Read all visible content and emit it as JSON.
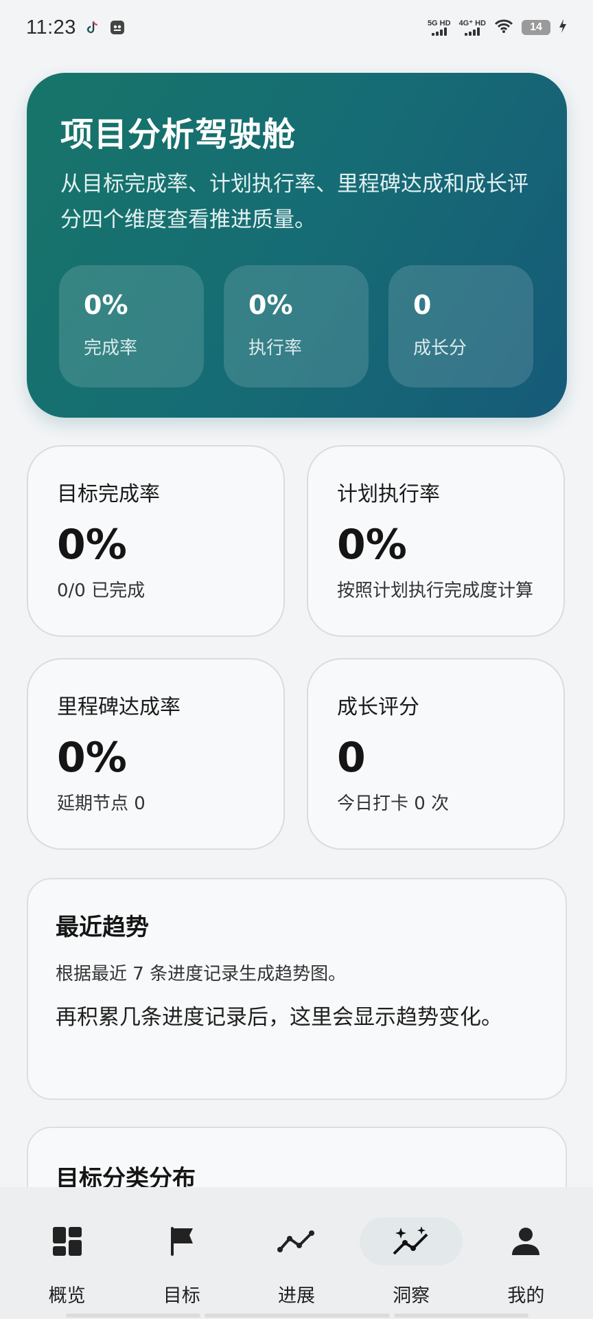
{
  "status_bar": {
    "time": "11:23",
    "net1": "5G HD",
    "net2": "4G⁺ HD",
    "battery": "14"
  },
  "hero": {
    "title": "项目分析驾驶舱",
    "description": "从目标完成率、计划执行率、里程碑达成和成长评分四个维度查看推进质量。",
    "stats": [
      {
        "value": "0%",
        "label": "完成率"
      },
      {
        "value": "0%",
        "label": "执行率"
      },
      {
        "value": "0",
        "label": "成长分"
      }
    ]
  },
  "metrics": [
    {
      "title": "目标完成率",
      "value": "0%",
      "note": "0/0 已完成"
    },
    {
      "title": "计划执行率",
      "value": "0%",
      "note": "按照计划执行完成度计算"
    },
    {
      "title": "里程碑达成率",
      "value": "0%",
      "note": "延期节点 0"
    },
    {
      "title": "成长评分",
      "value": "0",
      "note": "今日打卡 0 次"
    }
  ],
  "trend": {
    "title": "最近趋势",
    "description": "根据最近 7 条进度记录生成趋势图。",
    "empty_message": "再积累几条进度记录后，这里会显示趋势变化。"
  },
  "category": {
    "title": "目标分类分布"
  },
  "nav": {
    "items": [
      {
        "label": "概览",
        "icon": "dashboard-icon"
      },
      {
        "label": "目标",
        "icon": "flag-icon"
      },
      {
        "label": "进展",
        "icon": "trend-line-icon"
      },
      {
        "label": "洞察",
        "icon": "insight-sparkle-icon"
      },
      {
        "label": "我的",
        "icon": "person-icon"
      }
    ],
    "active": "洞察"
  }
}
